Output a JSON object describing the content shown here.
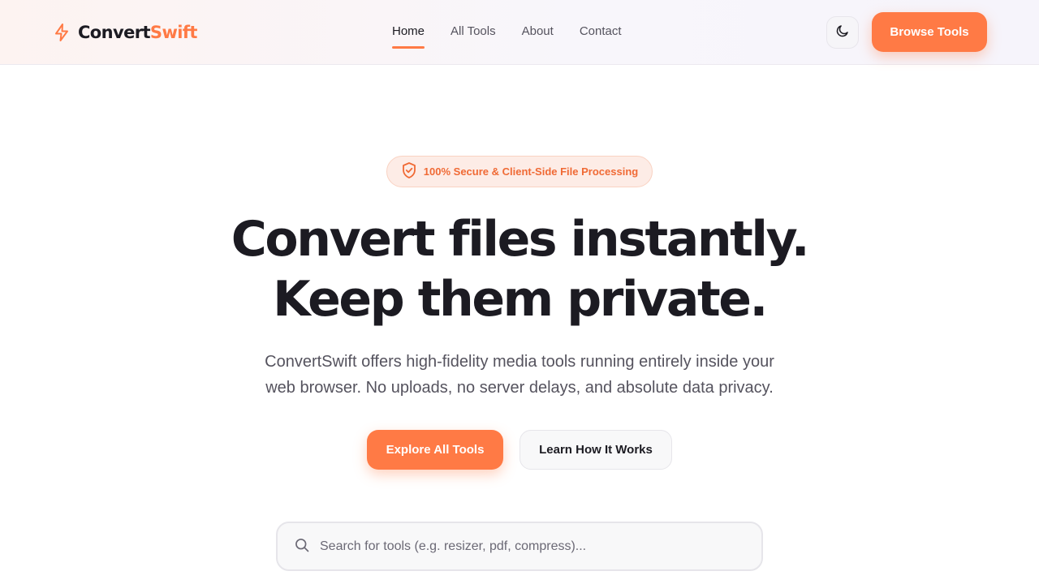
{
  "brand": {
    "name_part1": "Convert",
    "name_part2": "Swift",
    "accent_color": "#ff7a45",
    "logo_icon": "bolt-icon"
  },
  "nav": {
    "items": [
      {
        "label": "Home",
        "active": true
      },
      {
        "label": "All Tools",
        "active": false
      },
      {
        "label": "About",
        "active": false
      },
      {
        "label": "Contact",
        "active": false
      }
    ]
  },
  "header": {
    "theme_toggle_icon": "moon-icon",
    "browse_label": "Browse Tools"
  },
  "hero": {
    "badge_icon": "shield-check-icon",
    "badge_text": "100% Secure & Client-Side File Processing",
    "headline_line1": "Convert files instantly.",
    "headline_line2": "Keep them private.",
    "subtext_line1": "ConvertSwift offers high-fidelity media tools running entirely inside your",
    "subtext_line2": "web browser. No uploads, no server delays, and absolute data privacy.",
    "primary_cta": "Explore All Tools",
    "secondary_cta": "Learn How It Works"
  },
  "search": {
    "icon": "search-icon",
    "value": "",
    "placeholder": "Search for tools (e.g. resizer, pdf, compress)..."
  }
}
